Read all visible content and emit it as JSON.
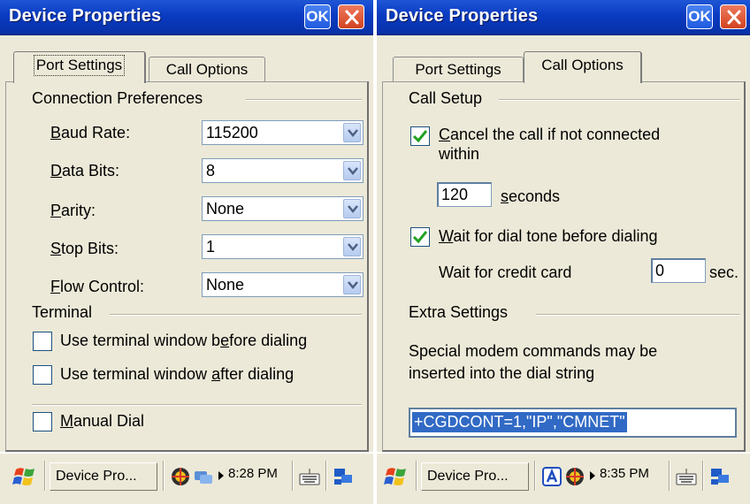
{
  "left": {
    "window_title": "Device Properties",
    "ok_label": "OK",
    "tabs": [
      {
        "label": "Port Settings",
        "active": true
      },
      {
        "label": "Call Options",
        "active": false
      }
    ],
    "connection_group": "Connection Preferences",
    "fields": [
      {
        "pre": "",
        "u": "B",
        "post": "aud Rate:",
        "value": "115200"
      },
      {
        "pre": "",
        "u": "D",
        "post": "ata Bits:",
        "value": "8"
      },
      {
        "pre": "",
        "u": "P",
        "post": "arity:",
        "value": "None"
      },
      {
        "pre": "",
        "u": "S",
        "post": "top Bits:",
        "value": "1"
      },
      {
        "pre": "",
        "u": "F",
        "post": "low Control:",
        "value": "None"
      }
    ],
    "terminal_group": "Terminal",
    "checkboxes": [
      {
        "pre": "Use terminal window b",
        "u": "e",
        "post": "fore dialing",
        "checked": false
      },
      {
        "pre": "Use terminal window ",
        "u": "a",
        "post": "fter dialing",
        "checked": false
      },
      {
        "pre": "",
        "u": "M",
        "post": "anual Dial",
        "checked": false
      }
    ],
    "taskbar": {
      "task_label": "Device Pro...",
      "time": "8:28 PM"
    }
  },
  "right": {
    "window_title": "Device Properties",
    "ok_label": "OK",
    "tabs": [
      {
        "label": "Port Settings",
        "active": false
      },
      {
        "label": "Call Options",
        "active": true
      }
    ],
    "call_setup_group": "Call Setup",
    "cancel_check": {
      "pre": "",
      "u": "C",
      "post": "ancel the call if not connected",
      "line2": "within",
      "checked": true
    },
    "timeout_value": "120",
    "seconds_label": {
      "pre": "",
      "u": "s",
      "post": "econds"
    },
    "dial_tone_check": {
      "pre": "",
      "u": "W",
      "post": "ait for dial tone before dialing",
      "checked": true
    },
    "credit_card_label": "Wait for credit card",
    "credit_card_value": "0",
    "sec_label": "sec.",
    "extra_group": "Extra Settings",
    "extra_desc_line1": "Special modem commands may be",
    "extra_desc_line2": "inserted into the dial string",
    "modem_command": "+CGDCONT=1,\"IP\",\"CMNET\"",
    "taskbar": {
      "task_label": "Device Pro...",
      "time": "8:35 PM"
    }
  }
}
